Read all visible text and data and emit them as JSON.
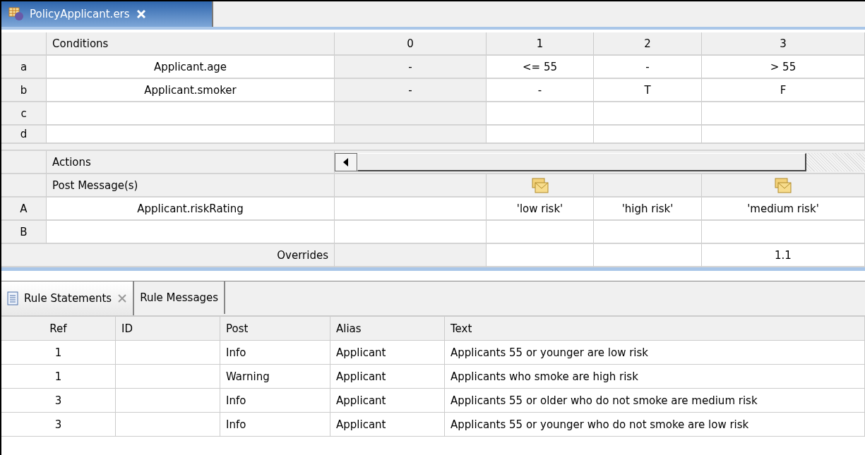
{
  "editor_tab": {
    "title": "PolicyApplicant.ers",
    "selected": true
  },
  "rule_table": {
    "conditions_label": "Conditions",
    "conditions": [
      {
        "id": "a",
        "expression": "Applicant.age"
      },
      {
        "id": "b",
        "expression": "Applicant.smoker"
      },
      {
        "id": "c"
      },
      {
        "id": "d"
      }
    ],
    "actions_label": "Actions",
    "post_messages_label": "Post Message(s)",
    "actions": [
      {
        "id": "A",
        "expression": "Applicant.riskRating"
      },
      {
        "id": "B"
      }
    ],
    "overrides_label": "Overrides",
    "rules": [
      {
        "number": "0",
        "conditions": [
          "-",
          "-"
        ],
        "post_message": false
      },
      {
        "number": "1",
        "conditions": [
          "<= 55",
          "-"
        ],
        "post_message": true,
        "actions": [
          "'low risk'"
        ]
      },
      {
        "number": "2",
        "conditions": [
          "-",
          "T"
        ],
        "post_message": false,
        "actions": [
          "'high risk'"
        ]
      },
      {
        "number": "3",
        "conditions": [
          "> 55",
          "F"
        ],
        "post_message": true,
        "actions": [
          "'medium risk'"
        ],
        "override": "1.1"
      }
    ]
  },
  "bottom_tabs": [
    {
      "label": "Rule Statements",
      "selected": true,
      "closable": true
    },
    {
      "label": "Rule Messages",
      "selected": false,
      "closable": false
    }
  ],
  "statements": {
    "columns": [
      "Ref",
      "ID",
      "Post",
      "Alias",
      "Text"
    ],
    "rows": [
      {
        "ref": "1",
        "post": "Info",
        "alias": "Applicant",
        "text": "Applicants 55 or younger are low risk"
      },
      {
        "ref": "1",
        "post": "Warning",
        "alias": "Applicant",
        "text": "Applicants who smoke are high risk"
      },
      {
        "ref": "3",
        "post": "Info",
        "alias": "Applicant",
        "text": "Applicants 55 or older who do not smoke are medium risk"
      },
      {
        "ref": "3",
        "post": "Info",
        "alias": "Applicant",
        "text": "Applicants 55 or younger who do not smoke are low risk"
      }
    ]
  }
}
